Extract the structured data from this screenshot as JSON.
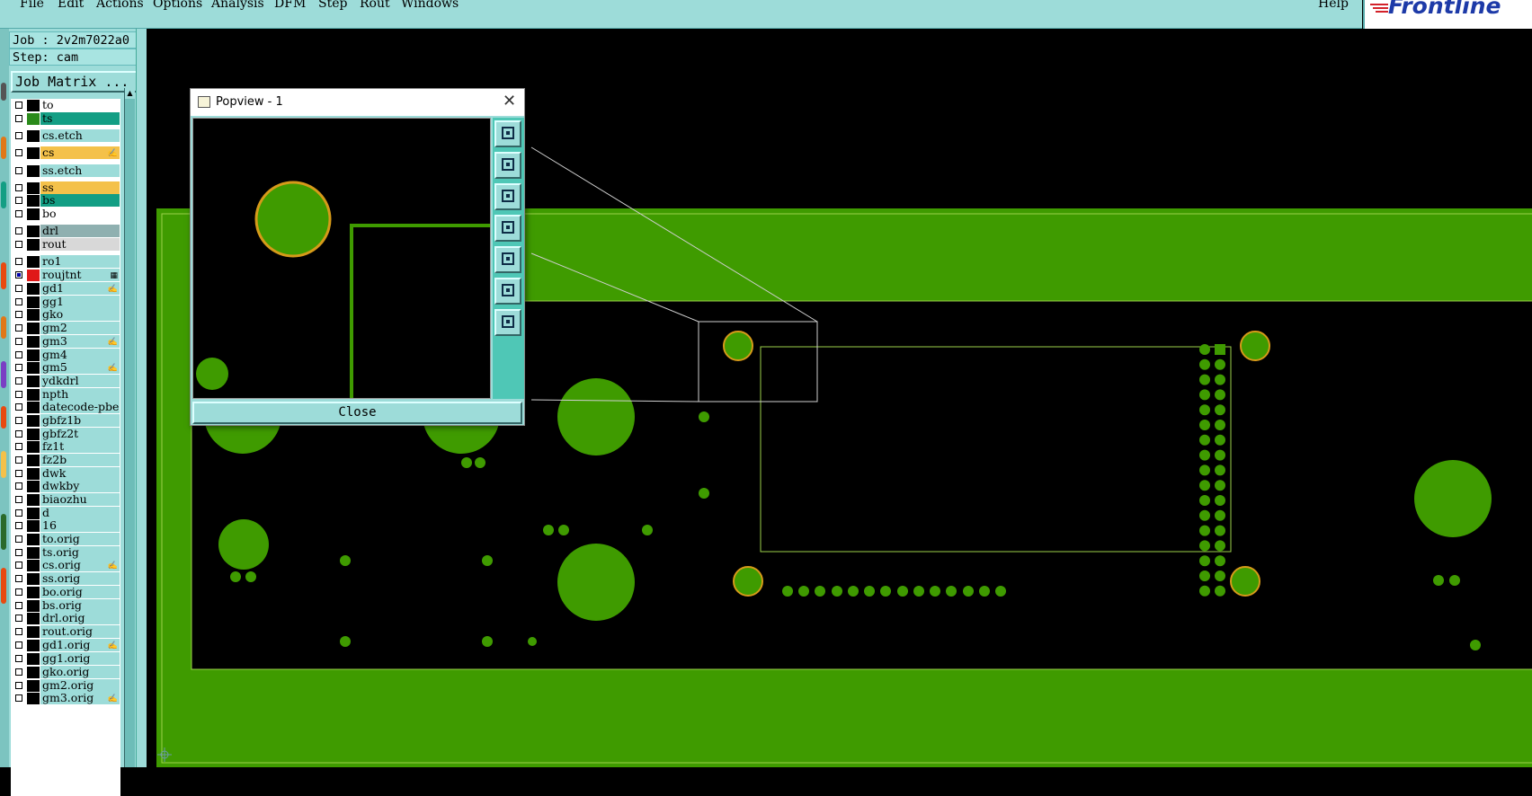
{
  "menu": {
    "file": "File",
    "edit": "Edit",
    "actions": "Actions",
    "options": "Options",
    "analysis": "Analysis",
    "dfm": "DFM",
    "step": "Step",
    "rout": "Rout",
    "windows": "Windows",
    "help": "Help"
  },
  "logo": {
    "text": "Frontline"
  },
  "job": {
    "job_line": "Job : 2v2m7022a0",
    "step_line": "Step: cam",
    "matrix_label": "Job Matrix ..."
  },
  "layers": [
    {
      "name": "to",
      "color": "#ffffff",
      "swatch": "#000000"
    },
    {
      "name": "ts",
      "color": "#139e84",
      "swatch": "#2a8a1a"
    },
    {
      "name": "cs.etch",
      "color": "#9ddcd9",
      "swatch": "#000000"
    },
    {
      "name": "cs",
      "color": "#f4c14a",
      "swatch": "#000000",
      "mark": "✍"
    },
    {
      "name": "ss.etch",
      "color": "#9ddcd9",
      "swatch": "#000000"
    },
    {
      "name": "ss",
      "color": "#f4c14a",
      "swatch": "#000000"
    },
    {
      "name": "bs",
      "color": "#139e84",
      "swatch": "#000000"
    },
    {
      "name": "bo",
      "color": "#ffffff",
      "swatch": "#000000"
    },
    {
      "name": "drl",
      "color": "#8fb0b0",
      "swatch": "#000000"
    },
    {
      "name": "rout",
      "color": "#d8d8d8",
      "swatch": "#000000"
    },
    {
      "name": "ro1",
      "color": "#9ddcd9",
      "swatch": "#000000"
    },
    {
      "name": "roujtnt",
      "color": "#9ddcd9",
      "swatch": "#e01818",
      "mark": "▦",
      "checked": true
    },
    {
      "name": "gd1",
      "color": "#9ddcd9",
      "swatch": "#000000",
      "mark": "✍"
    },
    {
      "name": "gg1",
      "color": "#9ddcd9",
      "swatch": "#000000"
    },
    {
      "name": "gko",
      "color": "#9ddcd9",
      "swatch": "#000000"
    },
    {
      "name": "gm2",
      "color": "#9ddcd9",
      "swatch": "#000000"
    },
    {
      "name": "gm3",
      "color": "#9ddcd9",
      "swatch": "#000000",
      "mark": "✍"
    },
    {
      "name": "gm4",
      "color": "#9ddcd9",
      "swatch": "#000000"
    },
    {
      "name": "gm5",
      "color": "#9ddcd9",
      "swatch": "#000000",
      "mark": "✍"
    },
    {
      "name": "ydkdrl",
      "color": "#9ddcd9",
      "swatch": "#000000"
    },
    {
      "name": "npth",
      "color": "#9ddcd9",
      "swatch": "#000000"
    },
    {
      "name": "datecode-pbe",
      "color": "#9ddcd9",
      "swatch": "#000000"
    },
    {
      "name": "gbfz1b",
      "color": "#9ddcd9",
      "swatch": "#000000"
    },
    {
      "name": "gbfz2t",
      "color": "#9ddcd9",
      "swatch": "#000000"
    },
    {
      "name": "fz1t",
      "color": "#9ddcd9",
      "swatch": "#000000"
    },
    {
      "name": "fz2b",
      "color": "#9ddcd9",
      "swatch": "#000000"
    },
    {
      "name": "dwk",
      "color": "#9ddcd9",
      "swatch": "#000000"
    },
    {
      "name": "dwkby",
      "color": "#9ddcd9",
      "swatch": "#000000"
    },
    {
      "name": "biaozhu",
      "color": "#9ddcd9",
      "swatch": "#000000"
    },
    {
      "name": "d",
      "color": "#9ddcd9",
      "swatch": "#000000"
    },
    {
      "name": "16",
      "color": "#9ddcd9",
      "swatch": "#000000"
    },
    {
      "name": "to.orig",
      "color": "#9ddcd9",
      "swatch": "#000000"
    },
    {
      "name": "ts.orig",
      "color": "#9ddcd9",
      "swatch": "#000000"
    },
    {
      "name": "cs.orig",
      "color": "#9ddcd9",
      "swatch": "#000000",
      "mark": "✍"
    },
    {
      "name": "ss.orig",
      "color": "#9ddcd9",
      "swatch": "#000000"
    },
    {
      "name": "bo.orig",
      "color": "#9ddcd9",
      "swatch": "#000000"
    },
    {
      "name": "bs.orig",
      "color": "#9ddcd9",
      "swatch": "#000000"
    },
    {
      "name": "drl.orig",
      "color": "#9ddcd9",
      "swatch": "#000000"
    },
    {
      "name": "rout.orig",
      "color": "#9ddcd9",
      "swatch": "#000000"
    },
    {
      "name": "gd1.orig",
      "color": "#9ddcd9",
      "swatch": "#000000",
      "mark": "✍"
    },
    {
      "name": "gg1.orig",
      "color": "#9ddcd9",
      "swatch": "#000000"
    },
    {
      "name": "gko.orig",
      "color": "#9ddcd9",
      "swatch": "#000000"
    },
    {
      "name": "gm2.orig",
      "color": "#9ddcd9",
      "swatch": "#000000"
    },
    {
      "name": "gm3.orig",
      "color": "#9ddcd9",
      "swatch": "#000000",
      "mark": "✍"
    }
  ],
  "popview": {
    "title": "Popview - 1",
    "close_x": "✕",
    "close_label": "Close",
    "tools": [
      "zoom-window-icon",
      "pan-up-icon",
      "pan-down-icon",
      "pan-left-icon",
      "pan-right-icon",
      "zoom-fit-icon",
      "zoom-home-icon"
    ]
  },
  "colors": {
    "ui_teal": "#9ddcd9",
    "copper_green": "#3f9b00",
    "pad_ring_orange": "#d69a19",
    "outline_line": "#9bd04a"
  }
}
